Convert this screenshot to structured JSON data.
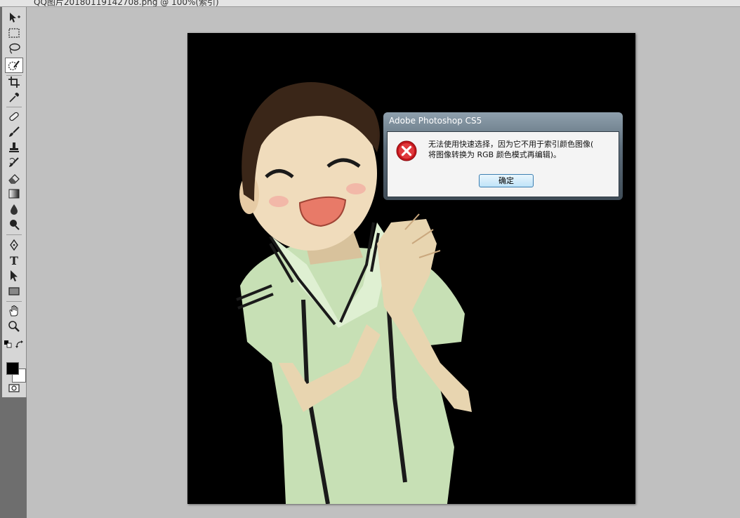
{
  "document": {
    "tab_title": "QQ图片20180119142708.png @ 100%(索引)"
  },
  "toolbar": {
    "tools": [
      {
        "name": "move-tool",
        "icon": "move-icon"
      },
      {
        "name": "rectangular-marquee-tool",
        "icon": "marquee-icon"
      },
      {
        "name": "lasso-tool",
        "icon": "lasso-icon"
      },
      {
        "name": "quick-selection-tool",
        "icon": "quick-selection-icon",
        "active": true
      },
      {
        "name": "crop-tool",
        "icon": "crop-icon"
      },
      {
        "name": "eyedropper-tool",
        "icon": "eyedropper-icon"
      },
      {
        "name": "healing-brush-tool",
        "icon": "bandage-icon"
      },
      {
        "name": "brush-tool",
        "icon": "brush-icon"
      },
      {
        "name": "clone-stamp-tool",
        "icon": "stamp-icon"
      },
      {
        "name": "history-brush-tool",
        "icon": "history-brush-icon"
      },
      {
        "name": "eraser-tool",
        "icon": "eraser-icon"
      },
      {
        "name": "gradient-tool",
        "icon": "gradient-icon"
      },
      {
        "name": "blur-tool",
        "icon": "drop-icon"
      },
      {
        "name": "dodge-tool",
        "icon": "dodge-icon"
      },
      {
        "name": "pen-tool",
        "icon": "pen-icon"
      },
      {
        "name": "type-tool",
        "icon": "type-icon"
      },
      {
        "name": "path-selection-tool",
        "icon": "arrow-icon"
      },
      {
        "name": "rectangle-tool",
        "icon": "rectangle-icon"
      },
      {
        "name": "hand-tool",
        "icon": "hand-icon"
      },
      {
        "name": "zoom-tool",
        "icon": "magnifier-icon"
      }
    ],
    "type_glyph": "T",
    "foreground_color": "#000000",
    "background_color": "#ffffff"
  },
  "dialog": {
    "title": "Adobe Photoshop CS5",
    "message_line1": "无法使用快速选择，因为它不用于索引颜色图像(",
    "message_line2": "将图像转换为 RGB 颜色模式再编辑)。",
    "ok_label": "确定",
    "icon": "error-icon"
  }
}
